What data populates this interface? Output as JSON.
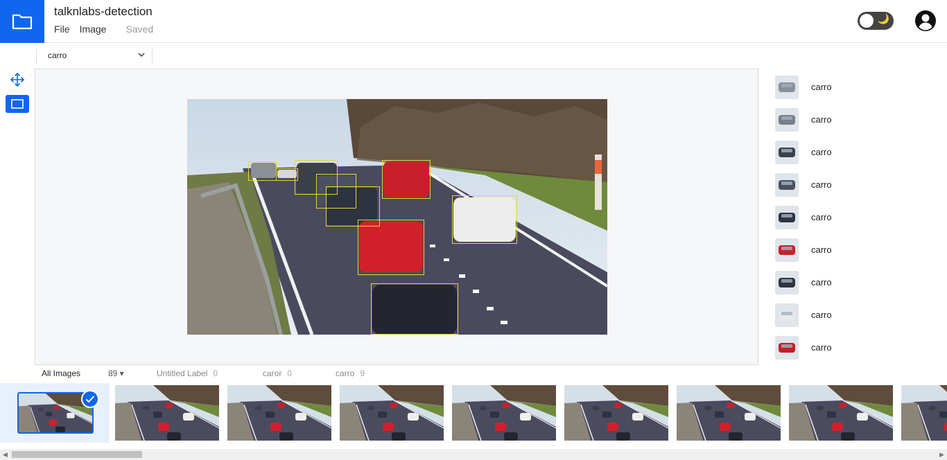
{
  "header": {
    "project_title": "talknlabs-detection",
    "menu": {
      "file": "File",
      "image": "Image",
      "status": "Saved"
    },
    "logo_icon": "folder-icon",
    "theme_icon": "moon-icon",
    "theme_moon_glyph": "🌙",
    "account_icon": "account-circle-icon"
  },
  "toolbar": {
    "selected_label": "carro",
    "chevron_icon": "chevron-down-icon"
  },
  "tools": {
    "move_icon": "move-icon",
    "rect_icon": "rectangle-icon",
    "active_tool": "rectangle"
  },
  "annotations": [
    {
      "label": "carro",
      "car_color": "#8a8f98"
    },
    {
      "label": "carro",
      "car_color": "#7a7f88"
    },
    {
      "label": "carro",
      "car_color": "#3c4048"
    },
    {
      "label": "carro",
      "car_color": "#4a5060"
    },
    {
      "label": "carro",
      "car_color": "#2e3340"
    },
    {
      "label": "carro",
      "car_color": "#c8202a"
    },
    {
      "label": "carro",
      "car_color": "#30343c"
    },
    {
      "label": "carro",
      "car_color": "#e8e8e8"
    },
    {
      "label": "carro",
      "car_color": "#c41e28"
    }
  ],
  "filters": [
    {
      "label": "All Images",
      "count": "89 ▾"
    },
    {
      "label": "Untitled Label",
      "count": "0"
    },
    {
      "label": "caror",
      "count": "0"
    },
    {
      "label": "carro",
      "count": "9"
    }
  ],
  "filmstrip": {
    "selected_index": 0,
    "check_icon": "check-icon",
    "count_visible": 9
  },
  "colors": {
    "accent": "#1166ee",
    "bbox": "#e8d43a"
  }
}
